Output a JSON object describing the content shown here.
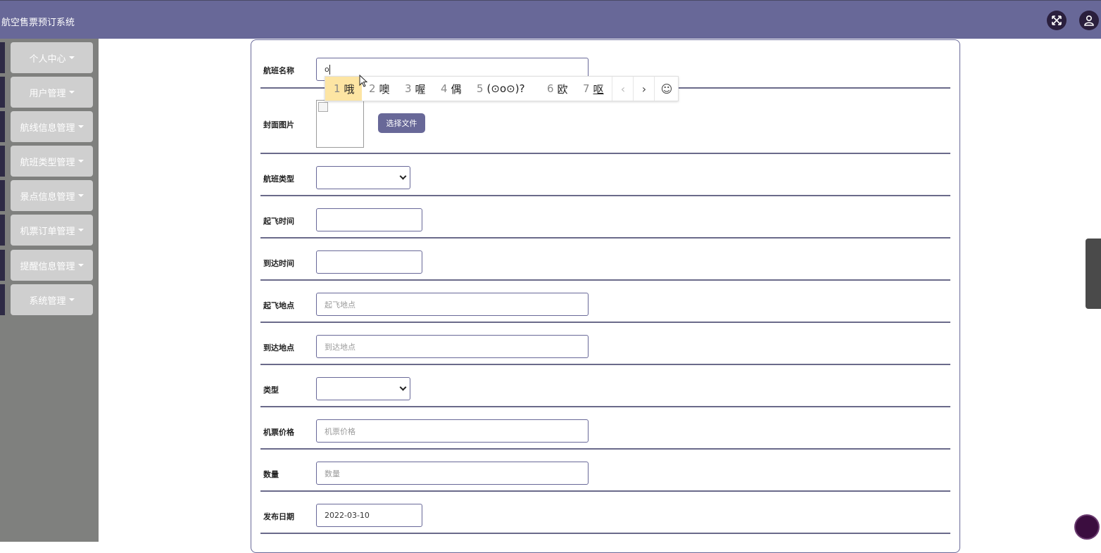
{
  "header": {
    "title": "航空售票预订系统",
    "bg_color": "#686898",
    "fullscreen_icon": "expand-arrows-icon",
    "user_icon": "user-icon"
  },
  "sidebar": {
    "items": [
      {
        "label": "个人中心"
      },
      {
        "label": "用户管理"
      },
      {
        "label": "航线信息管理"
      },
      {
        "label": "航班类型管理"
      },
      {
        "label": "景点信息管理"
      },
      {
        "label": "机票订单管理"
      },
      {
        "label": "提醒信息管理"
      },
      {
        "label": "系统管理"
      }
    ]
  },
  "form": {
    "flight_name": {
      "label": "航班名称",
      "value": "o"
    },
    "cover_image": {
      "label": "封面图片",
      "button": "选择文件"
    },
    "flight_type": {
      "label": "航班类型",
      "value": ""
    },
    "departure_time": {
      "label": "起飞时间",
      "value": ""
    },
    "arrival_time": {
      "label": "到达时间",
      "value": ""
    },
    "departure_place": {
      "label": "起飞地点",
      "placeholder": "起飞地点"
    },
    "arrival_place": {
      "label": "到达地点",
      "placeholder": "到达地点"
    },
    "type": {
      "label": "类型",
      "value": ""
    },
    "ticket_price": {
      "label": "机票价格",
      "placeholder": "机票价格"
    },
    "quantity": {
      "label": "数量",
      "placeholder": "数量"
    },
    "publish_date": {
      "label": "发布日期",
      "value": "2022-03-10"
    }
  },
  "ime": {
    "candidates": [
      {
        "num": "1",
        "text": "哦"
      },
      {
        "num": "2",
        "text": "噢"
      },
      {
        "num": "3",
        "text": "喔"
      },
      {
        "num": "4",
        "text": "偶"
      },
      {
        "num": "5",
        "text": "(⊙o⊙)?"
      },
      {
        "num": "6",
        "text": "欧"
      },
      {
        "num": "7",
        "text": "呕"
      }
    ],
    "prev": "‹",
    "next": "›",
    "emoji": "☺"
  }
}
